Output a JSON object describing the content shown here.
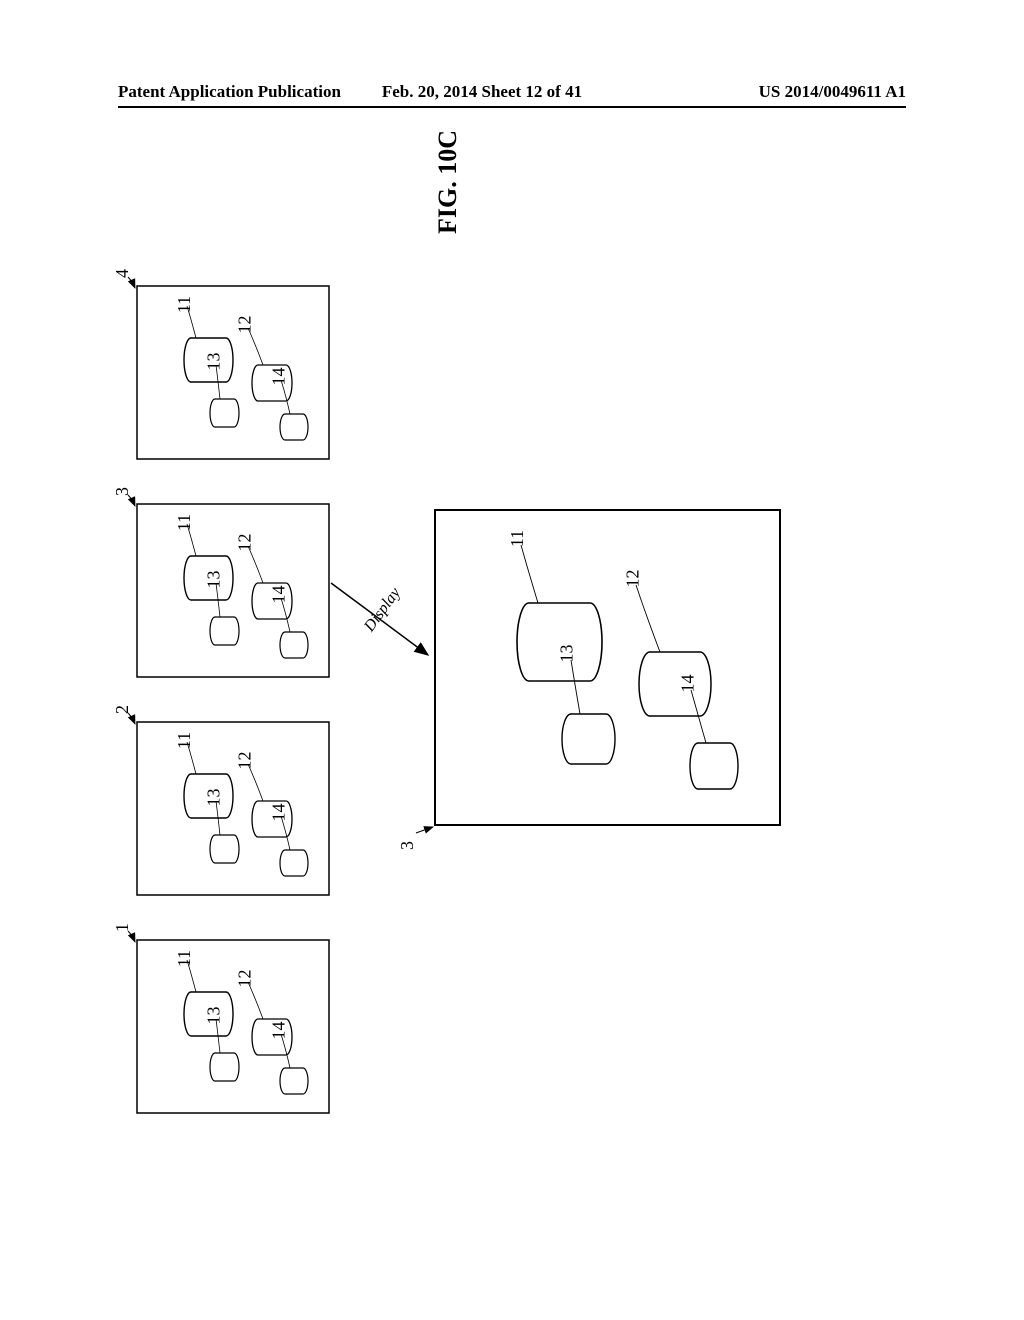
{
  "header": {
    "left": "Patent Application Publication",
    "center": "Feb. 20, 2014  Sheet 12 of 41",
    "right": "US 2014/0049611 A1"
  },
  "figure": {
    "label": "FIG. 10C"
  },
  "panels": [
    {
      "id": 1,
      "label": "1"
    },
    {
      "id": 2,
      "label": "2"
    },
    {
      "id": 3,
      "label": "3"
    },
    {
      "id": 4,
      "label": "4"
    }
  ],
  "big_panel": {
    "label": "3"
  },
  "objects": {
    "o11": "11",
    "o12": "12",
    "o13": "13",
    "o14": "14"
  },
  "display_label": "Display"
}
